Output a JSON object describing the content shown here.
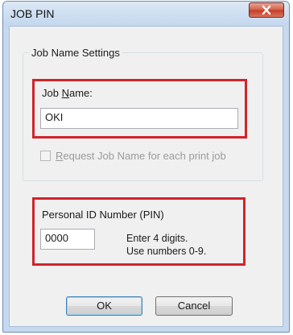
{
  "window": {
    "title": "JOB PIN"
  },
  "job_name_group": {
    "legend": "Job Name Settings",
    "label_before": "Job ",
    "label_mnemonic": "N",
    "label_after": "ame:",
    "value": "OKI",
    "checkbox": {
      "checked": false,
      "enabled": false,
      "label_mnemonic": "R",
      "label_rest": "equest Job Name for each print job"
    }
  },
  "pin_group": {
    "label": "Personal ID Number (PIN)",
    "value": "0000",
    "hint_line1": "Enter 4 digits.",
    "hint_line2": "Use numbers 0-9."
  },
  "buttons": {
    "ok": "OK",
    "cancel": "Cancel"
  },
  "colors": {
    "highlight": "#d2232a",
    "close_button": "#c23c24"
  },
  "icons": {
    "close": "close-icon"
  }
}
